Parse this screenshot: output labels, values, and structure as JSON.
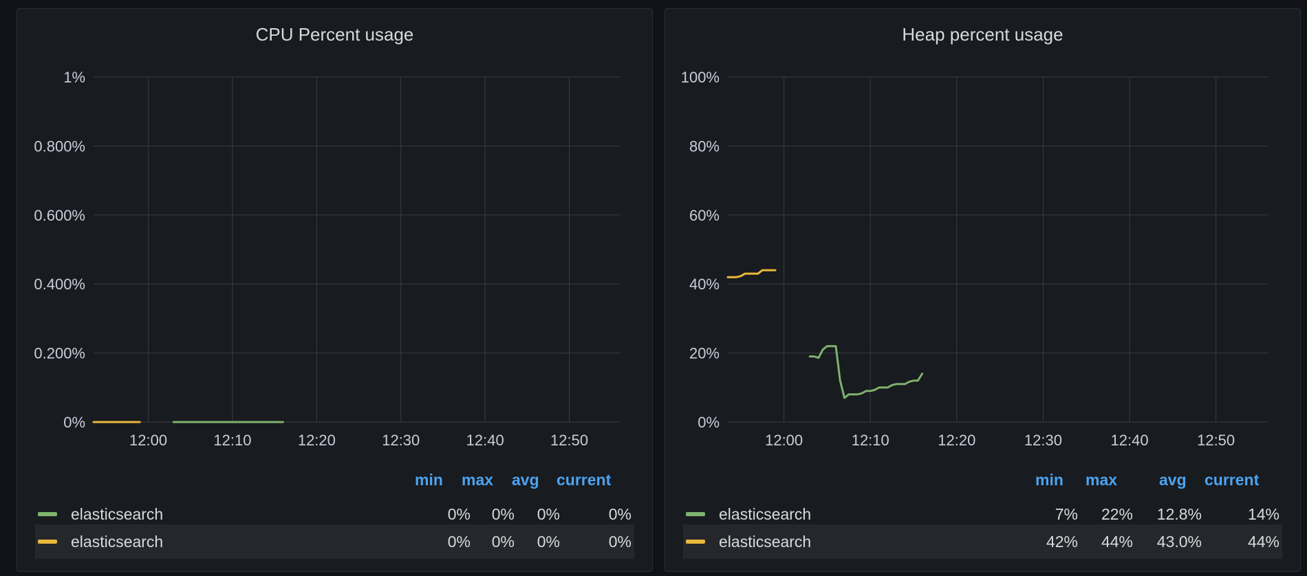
{
  "panels": [
    {
      "title": "CPU Percent usage",
      "legend": {
        "columns": {
          "min": "min",
          "max": "max",
          "avg": "avg",
          "current": "current"
        },
        "rows": [
          {
            "name": "elasticsearch",
            "color": "#7eb26d",
            "min": "0%",
            "max": "0%",
            "avg": "0%",
            "current": "0%"
          },
          {
            "name": "elasticsearch",
            "color": "#eab839",
            "min": "0%",
            "max": "0%",
            "avg": "0%",
            "current": "0%"
          }
        ]
      }
    },
    {
      "title": "Heap percent usage",
      "legend": {
        "columns": {
          "min": "min",
          "max": "max",
          "avg": "avg",
          "current": "current"
        },
        "rows": [
          {
            "name": "elasticsearch",
            "color": "#7eb26d",
            "min": "7%",
            "max": "22%",
            "avg": "12.8%",
            "current": "14%"
          },
          {
            "name": "elasticsearch",
            "color": "#eab839",
            "min": "42%",
            "max": "44%",
            "avg": "43.0%",
            "current": "44%"
          }
        ]
      }
    }
  ],
  "chart_data": [
    {
      "type": "line",
      "title": "CPU Percent usage",
      "xlim": [
        "11:53:30",
        "12:56:00"
      ],
      "x_ticks": [
        "12:00",
        "12:10",
        "12:20",
        "12:30",
        "12:40",
        "12:50"
      ],
      "ylim": [
        0,
        1
      ],
      "y_ticks": [
        0,
        0.2,
        0.4,
        0.6,
        0.8,
        1
      ],
      "y_tick_labels": [
        "0%",
        "0.200%",
        "0.400%",
        "0.600%",
        "0.800%",
        "1%"
      ],
      "grid": true,
      "legend_position": "bottom",
      "series": [
        {
          "name": "elasticsearch",
          "color": "#7eb26d",
          "x": [
            "12:03",
            "12:16"
          ],
          "y": [
            0,
            0
          ]
        },
        {
          "name": "elasticsearch",
          "color": "#eab839",
          "x": [
            "11:53:30",
            "11:59"
          ],
          "y": [
            0,
            0
          ]
        }
      ]
    },
    {
      "type": "line",
      "title": "Heap percent usage",
      "xlim": [
        "11:53:30",
        "12:56:00"
      ],
      "x_ticks": [
        "12:00",
        "12:10",
        "12:20",
        "12:30",
        "12:40",
        "12:50"
      ],
      "ylim": [
        0,
        100
      ],
      "y_ticks": [
        0,
        20,
        40,
        60,
        80,
        100
      ],
      "y_tick_labels": [
        "0%",
        "20%",
        "40%",
        "60%",
        "80%",
        "100%"
      ],
      "grid": true,
      "legend_position": "bottom",
      "series": [
        {
          "name": "elasticsearch",
          "color": "#7eb26d",
          "x": [
            "12:03",
            "12:03:30",
            "12:04",
            "12:04:30",
            "12:05",
            "12:05:30",
            "12:06",
            "12:06:30",
            "12:07",
            "12:07:30",
            "12:08",
            "12:08:30",
            "12:09",
            "12:09:30",
            "12:10",
            "12:10:30",
            "12:11",
            "12:11:30",
            "12:12",
            "12:12:30",
            "12:13",
            "12:13:30",
            "12:14",
            "12:14:30",
            "12:15",
            "12:15:30",
            "12:16"
          ],
          "y": [
            19,
            19,
            18.6,
            21,
            22,
            22,
            22,
            12,
            7,
            8,
            8,
            8,
            8.3,
            9,
            9,
            9.3,
            10,
            10,
            10,
            10.7,
            11,
            11,
            11,
            11.7,
            12,
            12,
            14
          ]
        },
        {
          "name": "elasticsearch",
          "color": "#eab839",
          "x": [
            "11:53:30",
            "11:54",
            "11:54:30",
            "11:55",
            "11:55:30",
            "11:56",
            "11:56:30",
            "11:57",
            "11:57:30",
            "11:58",
            "11:58:30",
            "11:59"
          ],
          "y": [
            42,
            42,
            42,
            42.3,
            43,
            43,
            43,
            43,
            44,
            44,
            44,
            44
          ]
        }
      ]
    }
  ]
}
